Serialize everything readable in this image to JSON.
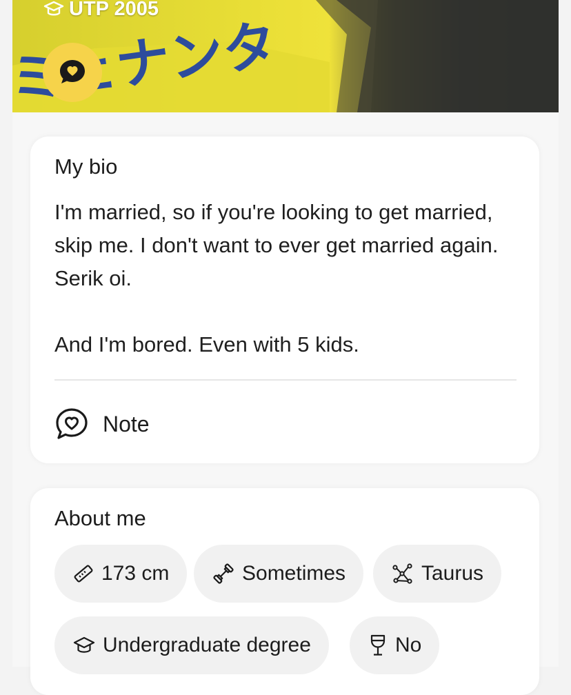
{
  "header": {
    "school": "UTP 2005",
    "photo_overlay_text": "ミェナンタ"
  },
  "bio": {
    "title": "My bio",
    "text": "I'm married, so if you're looking to get married, skip me. I don't want to ever get married again. Serik oi.\n\nAnd I'm bored. Even with 5 kids.",
    "note_label": "Note"
  },
  "about": {
    "title": "About me",
    "chips": [
      {
        "icon": "ruler-icon",
        "label": "173 cm"
      },
      {
        "icon": "dumbbell-icon",
        "label": "Sometimes"
      },
      {
        "icon": "zodiac-icon",
        "label": "Taurus"
      },
      {
        "icon": "graduation-cap-icon",
        "label": "Undergraduate degree"
      },
      {
        "icon": "wine-glass-icon",
        "label": "No"
      }
    ]
  },
  "colors": {
    "accent_yellow": "#f6d34a",
    "card_bg": "#ffffff",
    "chip_bg": "#f1f1f1",
    "text": "#1c1c1c"
  }
}
